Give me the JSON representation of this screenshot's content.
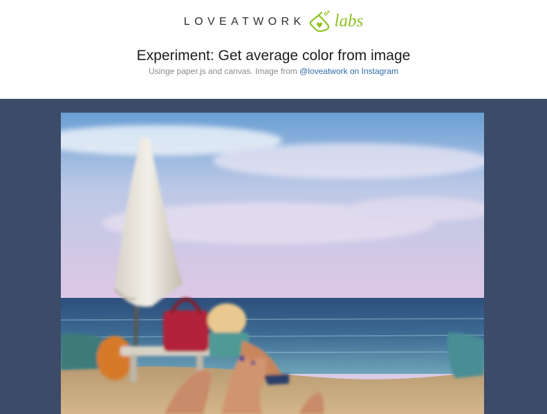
{
  "header": {
    "logo_word": "LOVEATWORK",
    "logo_icon": "flask-heart-icon",
    "logo_accent": "labs",
    "title": "Experiment: Get average color from image",
    "subtitle_prefix": "Usinge paper.js and canvas. Image from ",
    "subtitle_link": "@loveatwork on Instagram"
  },
  "stage": {
    "background_color": "#3c4c68",
    "image_alt": "Beach photo with umbrella, red bag, sunbather and feet in the sand"
  },
  "colors": {
    "brand_green": "#8dc21f",
    "link_blue": "#2d6aa8"
  }
}
